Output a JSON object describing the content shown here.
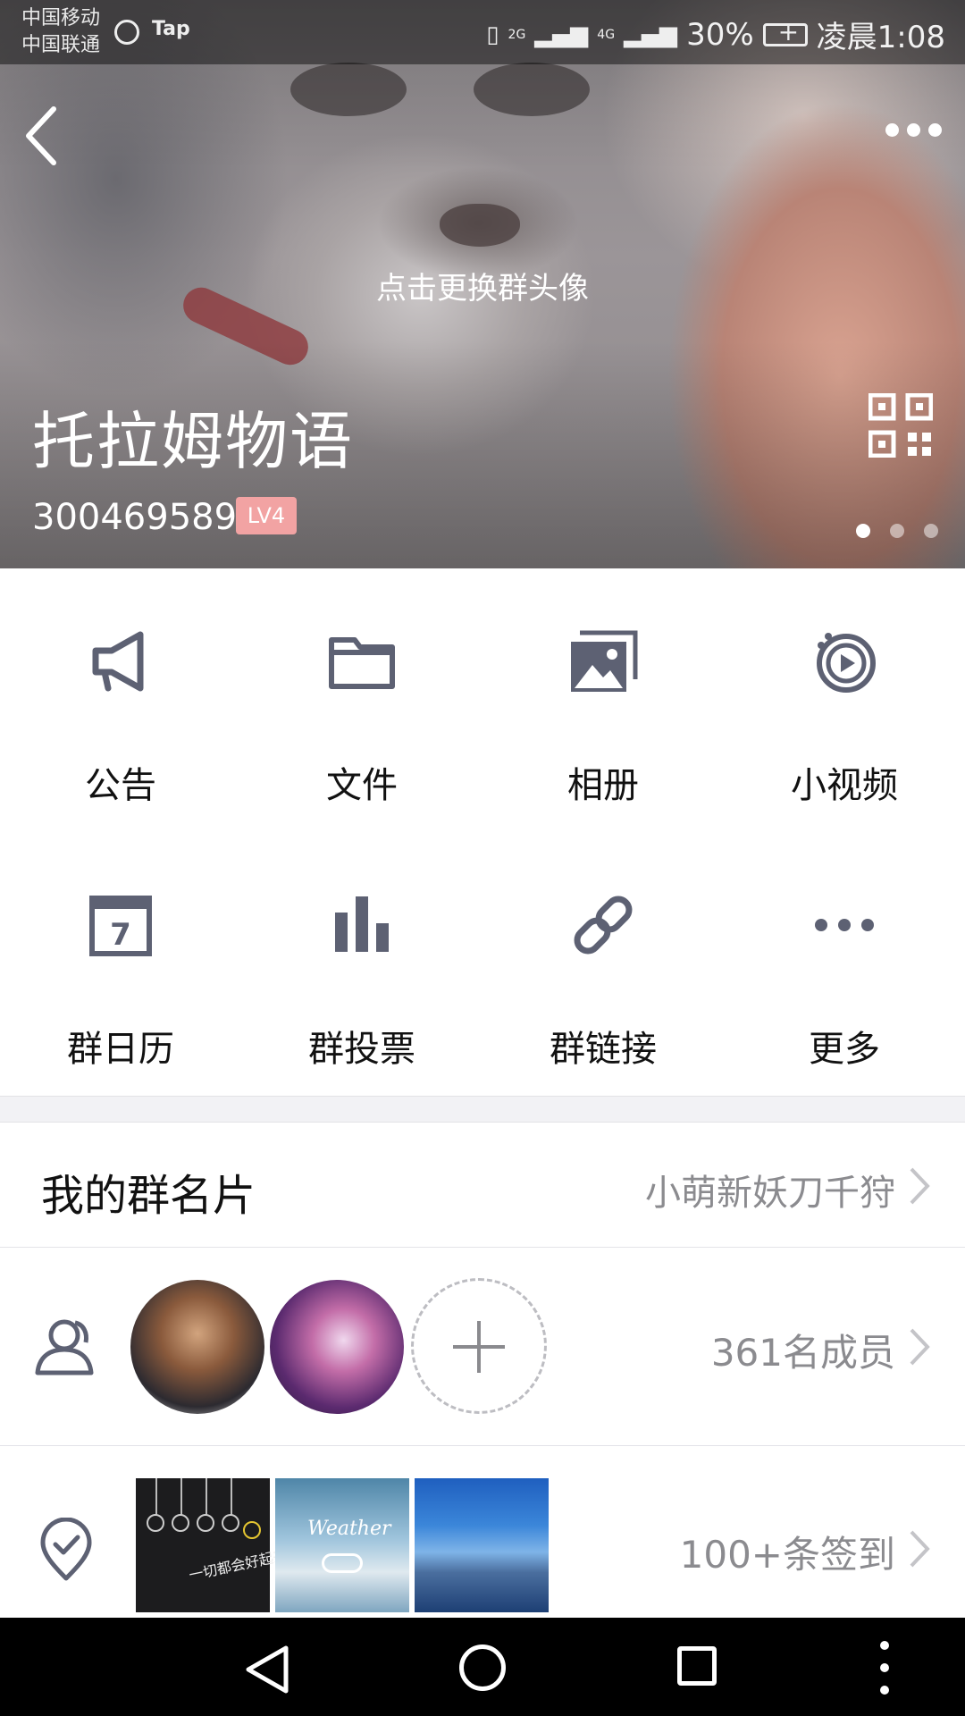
{
  "status_bar": {
    "carrier_1": "中国移动",
    "carrier_2": "中国联通",
    "tap_label": "Tap",
    "network_2g": "2G",
    "network_4g": "4G",
    "battery_percent": "30%",
    "time": "凌晨1:08"
  },
  "header": {
    "change_avatar_hint": "点击更换群头像",
    "group_name": "托拉姆物语",
    "group_id": "300469589",
    "level_badge": "LV4",
    "carousel": {
      "pages": 3,
      "active_index": 0
    }
  },
  "functions": [
    {
      "label": "公告",
      "icon": "megaphone-icon"
    },
    {
      "label": "文件",
      "icon": "folder-icon"
    },
    {
      "label": "相册",
      "icon": "album-icon"
    },
    {
      "label": "小视频",
      "icon": "video-icon"
    },
    {
      "label": "群日历",
      "icon": "calendar-icon",
      "calendar_day": "7"
    },
    {
      "label": "群投票",
      "icon": "bar-chart-icon"
    },
    {
      "label": "群链接",
      "icon": "link-icon"
    },
    {
      "label": "更多",
      "icon": "more-icon"
    }
  ],
  "my_card": {
    "title": "我的群名片",
    "value": "小萌新妖刀千狩"
  },
  "members": {
    "count_label": "361名成员"
  },
  "checkin": {
    "count_label": "100+条签到",
    "thumb_1_caption": "一切都会好起来的",
    "thumb_2_caption": "Weather"
  },
  "colors": {
    "icon_gray": "#5d6173",
    "secondary_text": "#8b8b8f",
    "badge_pink": "#f2a3a3"
  }
}
